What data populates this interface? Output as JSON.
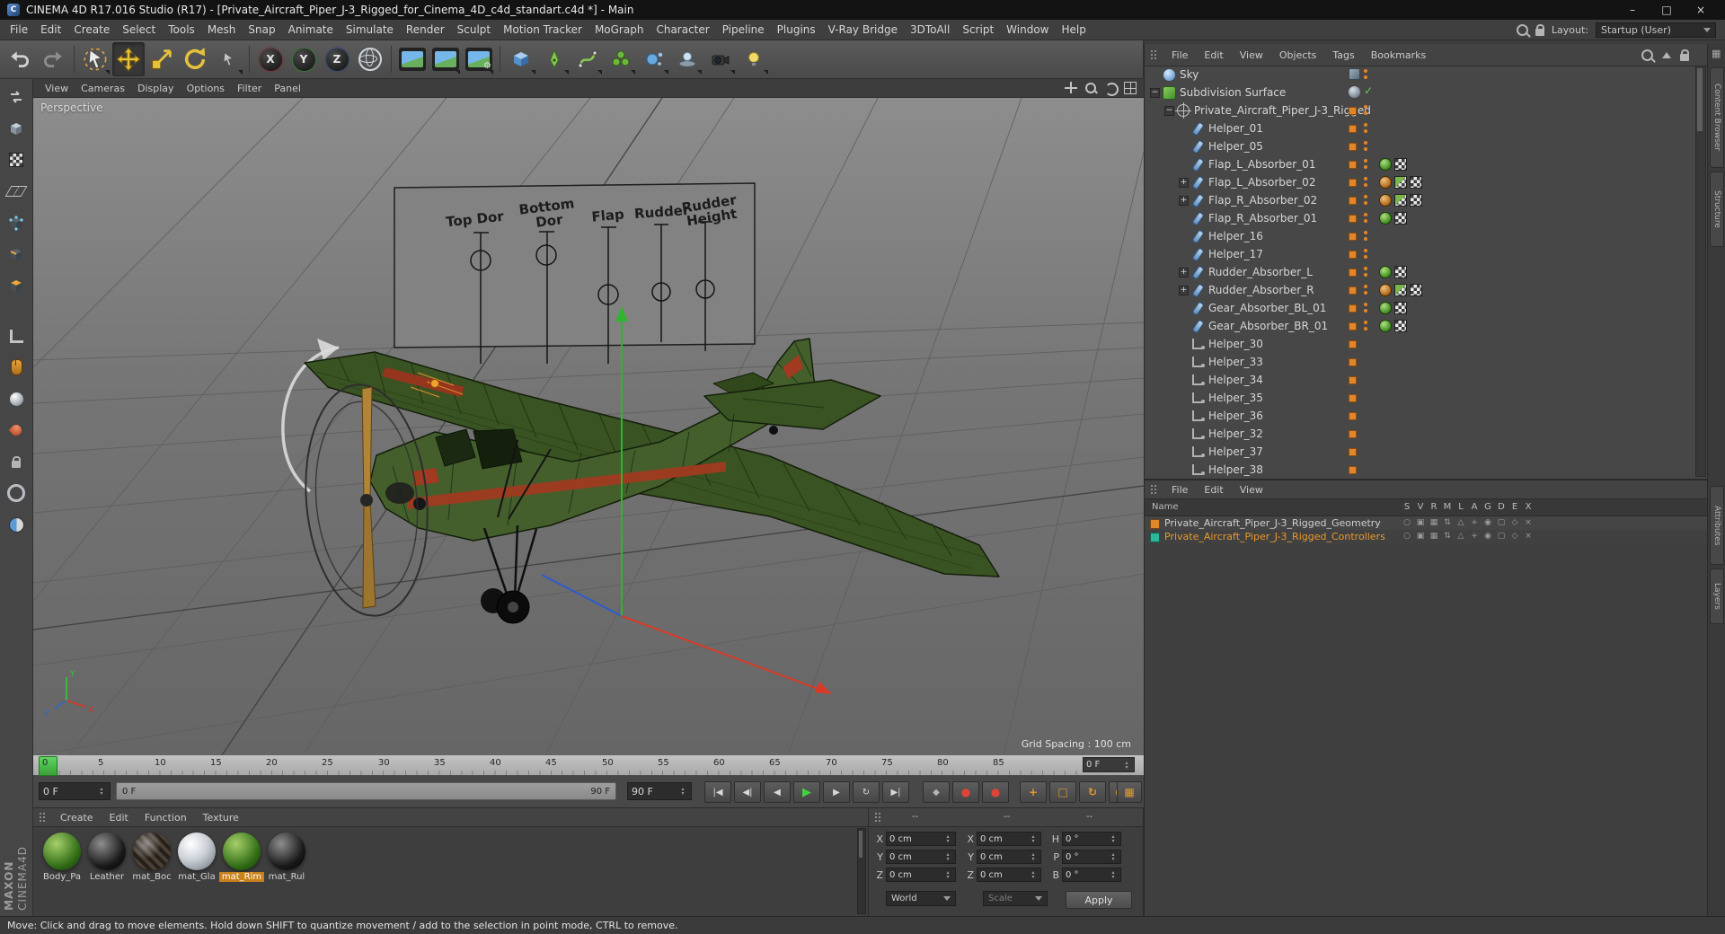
{
  "window": {
    "title": "CINEMA 4D R17.016 Studio (R17) - [Private_Aircraft_Piper_J-3_Rigged_for_Cinema_4D_c4d_standart.c4d *] - Main",
    "app_initial": "C",
    "minimize": "–",
    "restore": "□",
    "close": "×"
  },
  "menubar": {
    "items": [
      "File",
      "Edit",
      "Create",
      "Select",
      "Tools",
      "Mesh",
      "Snap",
      "Animate",
      "Simulate",
      "Render",
      "Sculpt",
      "Motion Tracker",
      "MoGraph",
      "Character",
      "Pipeline",
      "Plugins",
      "V-Ray Bridge",
      "3DToAll",
      "Script",
      "Window",
      "Help"
    ],
    "layout_label": "Layout:",
    "layout_value": "Startup (User)"
  },
  "toolbar": {
    "axis_x": "X",
    "axis_y": "Y",
    "axis_z": "Z"
  },
  "vp": {
    "menu": [
      "View",
      "Cameras",
      "Display",
      "Options",
      "Filter",
      "Panel"
    ],
    "label": "Perspective",
    "grid": "Grid Spacing : 100 cm",
    "board": [
      "Top Dor",
      "Bottom",
      "Dor",
      "Flap",
      "Rudder",
      "Rudder",
      "Height"
    ],
    "ax": {
      "x": "X",
      "y": "Y",
      "z": "Z"
    }
  },
  "om": {
    "menu": [
      "File",
      "Edit",
      "View",
      "Objects",
      "Tags",
      "Bookmarks"
    ],
    "items": [
      {
        "label": "Sky"
      },
      {
        "label": "Subdivision Surface"
      },
      {
        "label": "Private_Aircraft_Piper_J-3_Rigged"
      },
      {
        "label": "Helper_01"
      },
      {
        "label": "Helper_05"
      },
      {
        "label": "Flap_L_Absorber_01"
      },
      {
        "label": "Flap_L_Absorber_02"
      },
      {
        "label": "Flap_R_Absorber_02"
      },
      {
        "label": "Flap_R_Absorber_01"
      },
      {
        "label": "Helper_16"
      },
      {
        "label": "Helper_17"
      },
      {
        "label": "Rudder_Absorber_L"
      },
      {
        "label": "Rudder_Absorber_R"
      },
      {
        "label": "Gear_Absorber_BL_01"
      },
      {
        "label": "Gear_Absorber_BR_01"
      },
      {
        "label": "Helper_30"
      },
      {
        "label": "Helper_33"
      },
      {
        "label": "Helper_34"
      },
      {
        "label": "Helper_35"
      },
      {
        "label": "Helper_36"
      },
      {
        "label": "Helper_32"
      },
      {
        "label": "Helper_37"
      },
      {
        "label": "Helper_38"
      }
    ]
  },
  "layers": {
    "menu": [
      "File",
      "Edit",
      "View"
    ],
    "name": "Name",
    "cols": [
      "S",
      "V",
      "R",
      "M",
      "L",
      "A",
      "G",
      "D",
      "E",
      "X"
    ],
    "rows": [
      {
        "label": "Private_Aircraft_Piper_J-3_Rigged_Geometry",
        "color": "#e2862b"
      },
      {
        "label": "Private_Aircraft_Piper_J-3_Rigged_Controllers",
        "color": "#2ab89a"
      }
    ],
    "toggles": [
      "○",
      "▣",
      "▦",
      "⇅",
      "△",
      "+",
      "◉",
      "▢",
      "◇",
      "×"
    ]
  },
  "timeline": {
    "ticks": [
      "0",
      "5",
      "10",
      "15",
      "20",
      "25",
      "30",
      "35",
      "40",
      "45",
      "50",
      "55",
      "60",
      "65",
      "70",
      "75",
      "80",
      "85"
    ],
    "frame_box": "0 F",
    "current": "0 F",
    "range_start": "0 F",
    "range_end": "90 F",
    "end": "90 F"
  },
  "transport": {
    "goto_start": "|◀",
    "prev_key": "◀|",
    "prev_frame": "◀",
    "play": "▶",
    "next_frame": "▶",
    "cycle": "↻",
    "goto_end": "▶|",
    "key_diamond": "◆",
    "record": "●",
    "autokey": "●",
    "rec_pos": "+",
    "rec_scale": "□",
    "rec_rot": "↻",
    "rec_param": "P",
    "rec_pla": "▦",
    "keyframe_sel": "▦"
  },
  "materials": {
    "menu": [
      "Create",
      "Edit",
      "Function",
      "Texture"
    ],
    "items": [
      {
        "name": "Body_Pa"
      },
      {
        "name": "Leather"
      },
      {
        "name": "mat_Boc"
      },
      {
        "name": "mat_Gla"
      },
      {
        "name": "mat_Rim"
      },
      {
        "name": "mat_Rul"
      }
    ]
  },
  "coords": {
    "d1": "--",
    "d2": "--",
    "d3": "--",
    "r1": {
      "l1": "X",
      "v1": "0 cm",
      "l2": "X",
      "v2": "0 cm",
      "l3": "H",
      "v3": "0 °"
    },
    "r2": {
      "l1": "Y",
      "v1": "0 cm",
      "l2": "Y",
      "v2": "0 cm",
      "l3": "P",
      "v3": "0 °"
    },
    "r3": {
      "l1": "Z",
      "v1": "0 cm",
      "l2": "Z",
      "v2": "0 cm",
      "l3": "B",
      "v3": "0 °"
    },
    "world": "World",
    "scale": "Scale",
    "apply": "Apply"
  },
  "status": {
    "text": "Move: Click and drag to move elements. Hold down SHIFT to quantize movement / add to the selection in point mode, CTRL to remove."
  },
  "brand": {
    "maxon": "MAXON",
    "cinema": "CINEMA4D"
  },
  "edge_tabs": [
    "Content Browser",
    "Structure",
    "Attributes",
    "Layers"
  ]
}
